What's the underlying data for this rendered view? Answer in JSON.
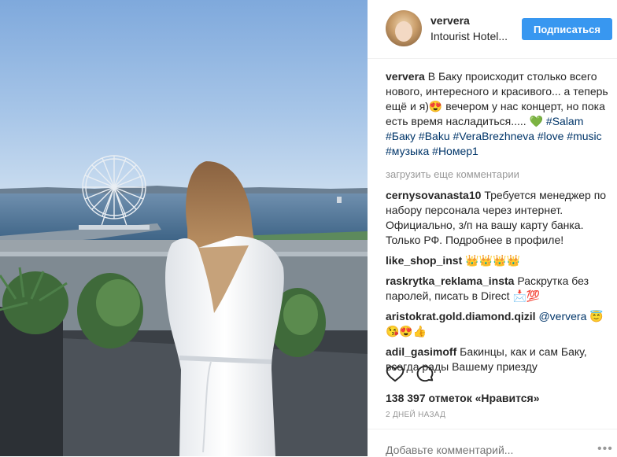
{
  "header": {
    "username": "ververa",
    "location": "Intourist Hotel...",
    "follow_label": "Подписаться"
  },
  "caption": {
    "author": "ververa",
    "text": "В Баку происходит столько всего нового, интересного и красивого... а теперь ещё и я)😍 вечером у нас концерт, но пока есть время насладиться..... 💚",
    "tags": "#Salam #Баку #Baku #VeraBrezhneva #love #music #музыка #Номер1"
  },
  "load_more_label": "загрузить еще комментарии",
  "comments": [
    {
      "author": "cernysovanasta10",
      "text": "Требуется менеджер по набору персонала через интернет. Официально, з/п на вашу карту банка. Только РФ. Подробнее в профиле!"
    },
    {
      "author": "like_shop_inst",
      "text": "👑👑👑👑"
    },
    {
      "author": "raskrytka_reklama_insta",
      "text": "Раскрутка без паролей, писать в Direct 📩💯"
    },
    {
      "author": "aristokrat.gold.diamond.qizil",
      "mention": "@ververa",
      "text": "😇😘😍👍"
    },
    {
      "author": "adil_gasimoff",
      "text": "Бакинцы, как и сам Баку, всегда рады Вашему приезду"
    }
  ],
  "likes": "138 397 отметок «Нравится»",
  "date": "2 ДНЕЙ НАЗАД",
  "add_comment_placeholder": "Добавьте комментарий...",
  "more_options": "•••",
  "icons": {
    "like": "heart-icon",
    "comment": "comment-icon",
    "more": "more-options-icon"
  },
  "colors": {
    "accent": "#3897f0",
    "tag": "#003569",
    "muted": "#999999"
  }
}
